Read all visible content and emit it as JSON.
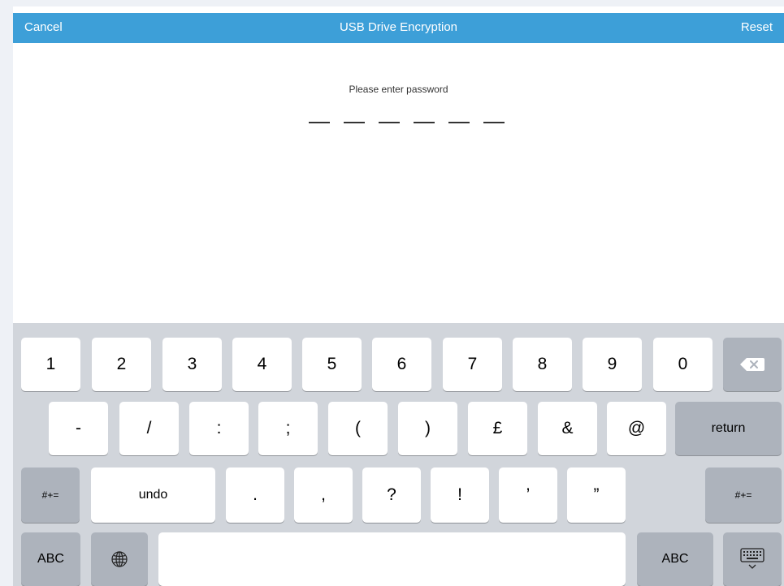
{
  "header": {
    "cancel_label": "Cancel",
    "title": "USB Drive Encryption",
    "reset_label": "Reset",
    "bar_color": "#3d9fd8"
  },
  "password": {
    "prompt": "Please enter password",
    "length": 6
  },
  "keyboard": {
    "row1": [
      "1",
      "2",
      "3",
      "4",
      "5",
      "6",
      "7",
      "8",
      "9",
      "0"
    ],
    "backspace_icon": "delete-backspace-icon",
    "row2": [
      "-",
      "/",
      ":",
      ";",
      "(",
      ")",
      "£",
      "&",
      "@"
    ],
    "return_label": "return",
    "symbols_label": "#+=",
    "undo_label": "undo",
    "row3": [
      ".",
      ",",
      "?",
      "!",
      "’",
      "”"
    ],
    "abc_label": "ABC",
    "globe_icon": "globe-icon",
    "space_label": "",
    "dismiss_icon": "keyboard-dismiss-icon",
    "background_color": "#d1d5db",
    "function_key_color": "#adb3bc"
  }
}
